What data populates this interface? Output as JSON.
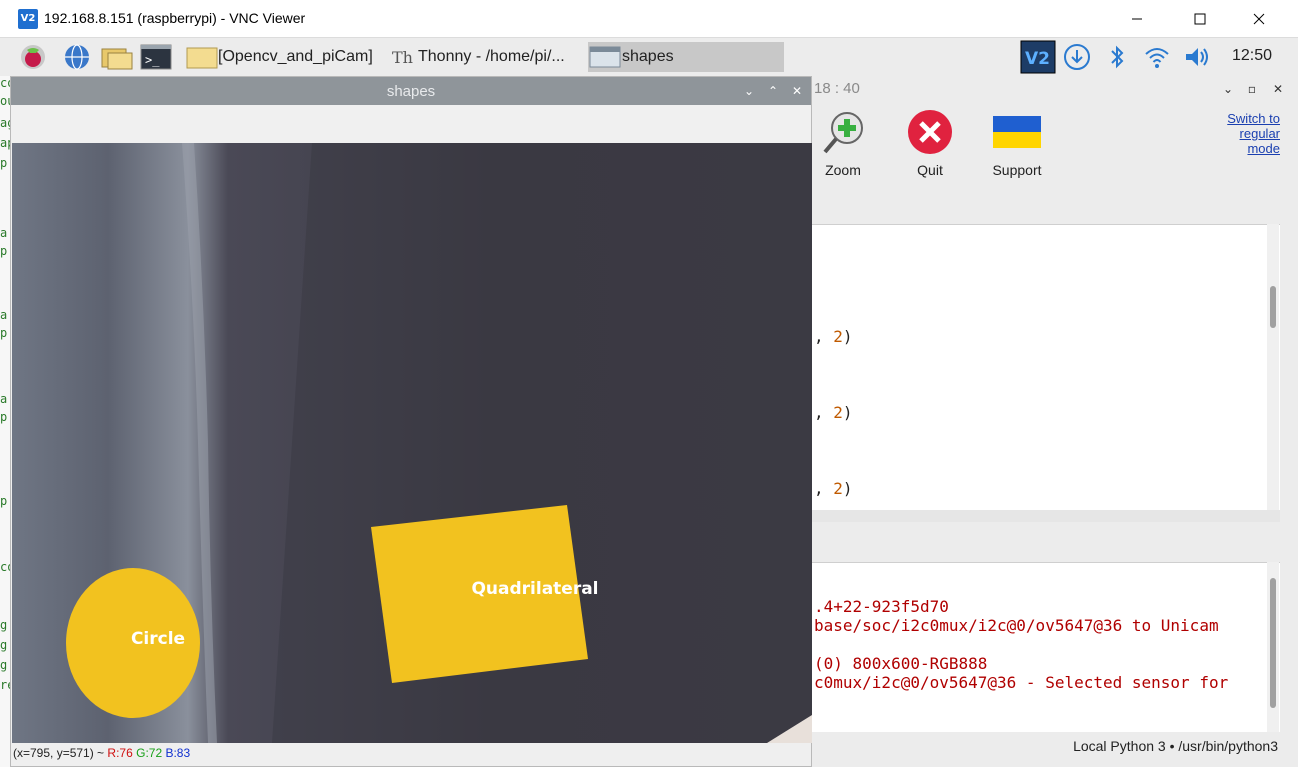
{
  "vnc": {
    "title": "192.168.8.151 (raspberrypi) - VNC Viewer",
    "logo_text": "V2",
    "minimize_icon": "minimize-icon",
    "maximize_icon": "maximize-icon",
    "close_icon": "close-icon"
  },
  "taskbar": {
    "items": [
      {
        "label": "[Opencv_and_piCam]",
        "icon": "folder-icon"
      },
      {
        "label": "Thonny  -  /home/pi/...",
        "icon": "thonny-icon"
      },
      {
        "label": "shapes",
        "icon": "window-icon"
      }
    ],
    "clock": "12:50"
  },
  "gutter": {
    "marks": [
      "co",
      "ou",
      "ag",
      "ap",
      "p",
      "a",
      "p",
      "a",
      "p",
      "a",
      "p",
      "p",
      "co",
      "g",
      "g",
      "g",
      "re"
    ]
  },
  "thonny": {
    "title_time": "18 : 40",
    "toolbar": [
      {
        "label": "Zoom",
        "icon": "zoom-icon"
      },
      {
        "label": "Quit",
        "icon": "quit-icon"
      },
      {
        "label": "Support",
        "icon": "ukraine-flag-icon"
      }
    ],
    "switch_link": "Switch to regular mode",
    "editor_lines": [
      {
        "prefix": ", ",
        "num": "2",
        "suffix": ")"
      },
      {
        "prefix": ", ",
        "num": "2",
        "suffix": ")"
      },
      {
        "prefix": ", ",
        "num": "2",
        "suffix": ")"
      }
    ],
    "shell_lines": [
      ".4+22-923f5d70",
      "base/soc/i2c0mux/i2c@0/ov5647@36 to Unicam",
      "",
      "(0) 800x600-RGB888",
      "c0mux/i2c@0/ov5647@36 - Selected sensor for"
    ],
    "status": "Local Python 3  •  /usr/bin/python3"
  },
  "shapes": {
    "title": "shapes",
    "labels": {
      "circle": "Circle",
      "quad": "Quadrilateral"
    },
    "coords": {
      "pos": "(x=795, y=571) ~ ",
      "r": "R:76",
      "g": "G:72",
      "b": "B:83"
    },
    "colors": {
      "shape_fill": "#f2c21f",
      "background": "#3f3d47"
    }
  }
}
